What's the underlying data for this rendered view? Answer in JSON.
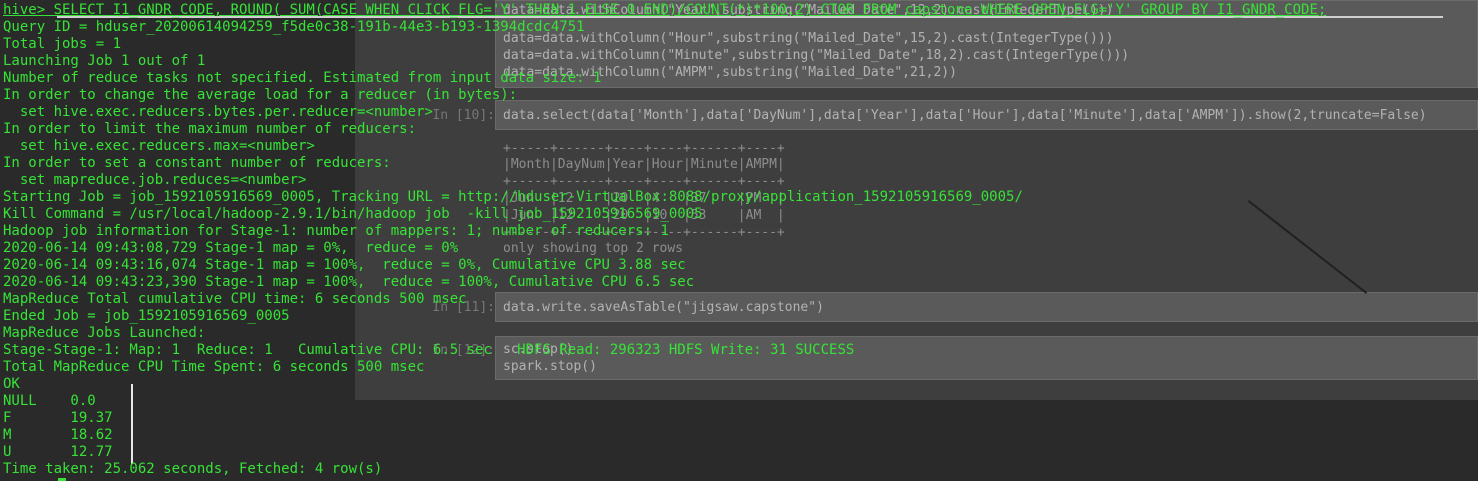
{
  "notebook": {
    "code_lines": [
      "data=data.withColumn(\"Year\",substring(\"Mailed_Date\",12,2).cast(IntegerType()))",
      "data=data.withColumn(\"Hour\",substring(\"Mailed_Date\",15,2).cast(IntegerType()))",
      "data=data.withColumn(\"Minute\",substring(\"Mailed_Date\",18,2).cast(IntegerType()))",
      "data=data.withColumn(\"AMPM\",substring(\"Mailed_Date\",21,2))"
    ],
    "prompt_10": "In [10]:",
    "cell_10": "data.select(data['Month'],data['DayNum'],data['Year'],data['Hour'],data['Minute'],data['AMPM']).show(2,truncate=False)",
    "table_border": "+-----+------+----+----+------+----+",
    "table_header": "|Month|DayNum|Year|Hour|Minute|AMPM|",
    "table_row_1": "|Jun  |12    |20  |4   |37    |PM  |",
    "table_row_2": "|Jun  |12    |20  |10  |53    |AM  |",
    "table_note": "only showing top 2 rows",
    "prompt_11": "In [11]:",
    "cell_11": "data.write.saveAsTable(\"jigsaw.capstone\")",
    "prompt_12": "In [12]:",
    "cell_12_line1": "sc.stop()",
    "cell_12_line2": "spark.stop()"
  },
  "terminal": {
    "lines": [
      "hive> SELECT I1_GNDR_CODE, ROUND( SUM(CASE WHEN CLICK_FLG='Y' THEN 1 ELSE 0 END)/COUNT(*)*100,2) CTOR FROM capstone WHERE OPEN_FLG='Y' GROUP BY I1_GNDR_CODE;",
      "Query ID = hduser_20200614094259_f5de0c38-191b-44e3-b193-1394dcdc4751",
      "Total jobs = 1",
      "Launching Job 1 out of 1",
      "Number of reduce tasks not specified. Estimated from input data size: 1",
      "In order to change the average load for a reducer (in bytes):",
      "  set hive.exec.reducers.bytes.per.reducer=<number>",
      "In order to limit the maximum number of reducers:",
      "  set hive.exec.reducers.max=<number>",
      "In order to set a constant number of reducers:",
      "  set mapreduce.job.reduces=<number>",
      "Starting Job = job_1592105916569_0005, Tracking URL = http://hduser-VirtualBox:8088/proxy/application_1592105916569_0005/",
      "Kill Command = /usr/local/hadoop-2.9.1/bin/hadoop job  -kill job_1592105916569_0005",
      "Hadoop job information for Stage-1: number of mappers: 1; number of reducers: 1",
      "2020-06-14 09:43:08,729 Stage-1 map = 0%,  reduce = 0%",
      "2020-06-14 09:43:16,074 Stage-1 map = 100%,  reduce = 0%, Cumulative CPU 3.88 sec",
      "2020-06-14 09:43:23,390 Stage-1 map = 100%,  reduce = 100%, Cumulative CPU 6.5 sec",
      "MapReduce Total cumulative CPU time: 6 seconds 500 msec",
      "Ended Job = job_1592105916569_0005",
      "MapReduce Jobs Launched:",
      "Stage-Stage-1: Map: 1  Reduce: 1   Cumulative CPU: 6.5 sec   HDFS Read: 296323 HDFS Write: 31 SUCCESS",
      "Total MapReduce CPU Time Spent: 6 seconds 500 msec",
      "OK",
      "NULL    0.0",
      "F       19.37",
      "M       18.62",
      "U       12.77",
      "Time taken: 25.062 seconds, Fetched: 4 row(s)"
    ]
  },
  "colors": {
    "terminal_text": "#36e336",
    "terminal_bg": "#2a2a2a"
  }
}
